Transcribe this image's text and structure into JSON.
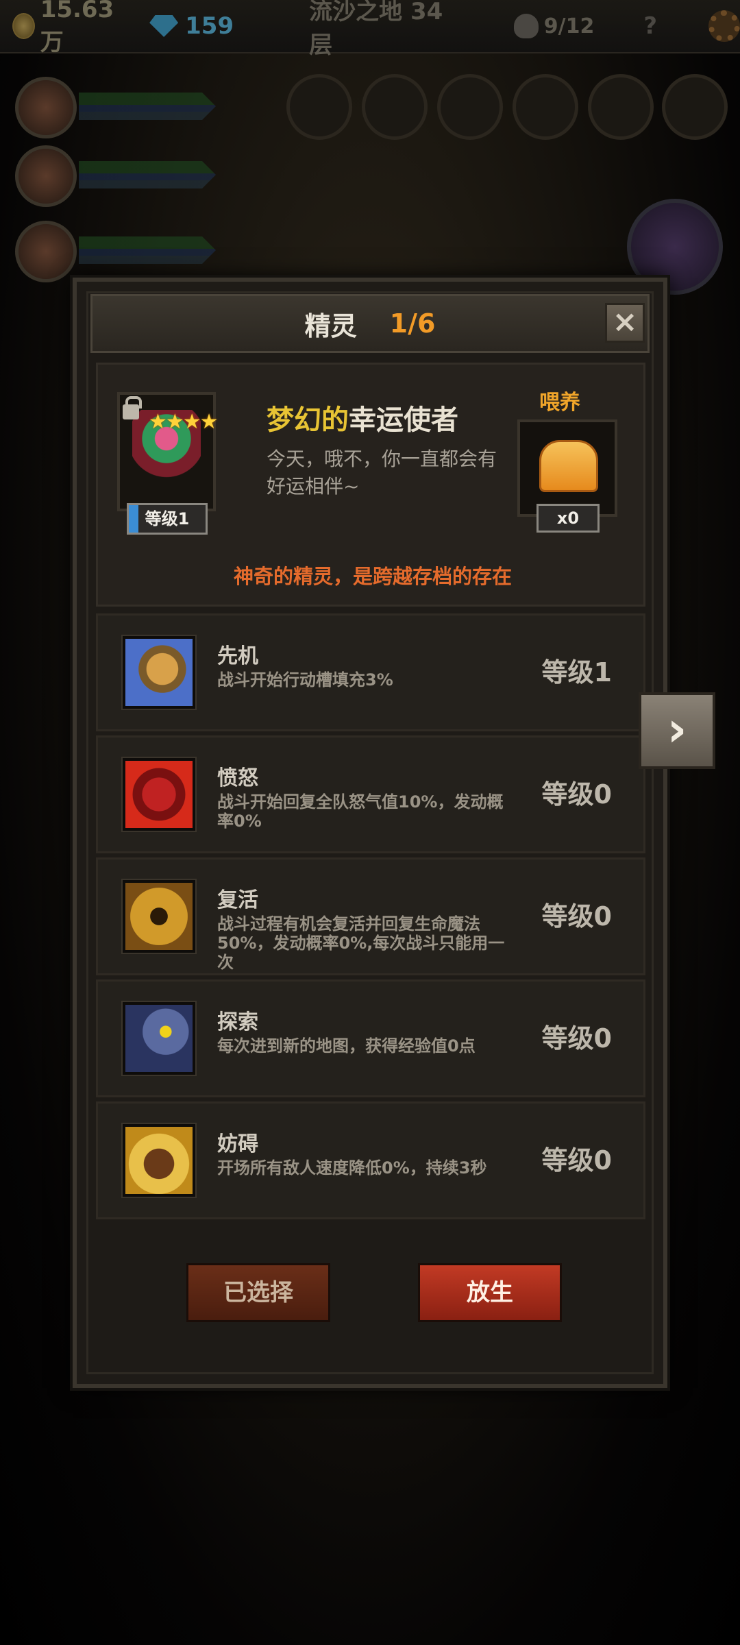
{
  "topbar": {
    "gold": "15.63万",
    "gems": "159",
    "map": "流沙之地 34层",
    "kills": "9/12",
    "help": "?"
  },
  "dialog": {
    "title": "精灵",
    "count": "1/6",
    "close": "×",
    "sprite": {
      "stars": "★★★★",
      "level": "等级1",
      "name_highlight": "梦幻的",
      "name_rest": "幸运使者",
      "description": "今天，哦不，你一直都会有好运相伴~",
      "feed_label": "喂养",
      "feed_count": "x0",
      "tagline": "神奇的精灵，是跨越存档的存在"
    },
    "skills": [
      {
        "name": "先机",
        "desc": "战斗开始行动槽填充3%",
        "level": "等级1",
        "icon": "leopard-icon"
      },
      {
        "name": "愤怒",
        "desc": "战斗开始回复全队怒气值10%，发动概率0%",
        "level": "等级0",
        "icon": "panther-icon"
      },
      {
        "name": "复活",
        "desc": "战斗过程有机会复活并回复生命魔法50%，发动概率0%,每次战斗只能用一次",
        "level": "等级0",
        "icon": "revive-icon"
      },
      {
        "name": "探索",
        "desc": "每次进到新的地图，获得经验值0点",
        "level": "等级0",
        "icon": "owl-icon"
      },
      {
        "name": "妨碍",
        "desc": "开场所有敌人速度降低0%，持续3秒",
        "level": "等级0",
        "icon": "chain-boot-icon"
      }
    ],
    "buttons": {
      "selected": "已选择",
      "release": "放生"
    },
    "next": "›"
  }
}
